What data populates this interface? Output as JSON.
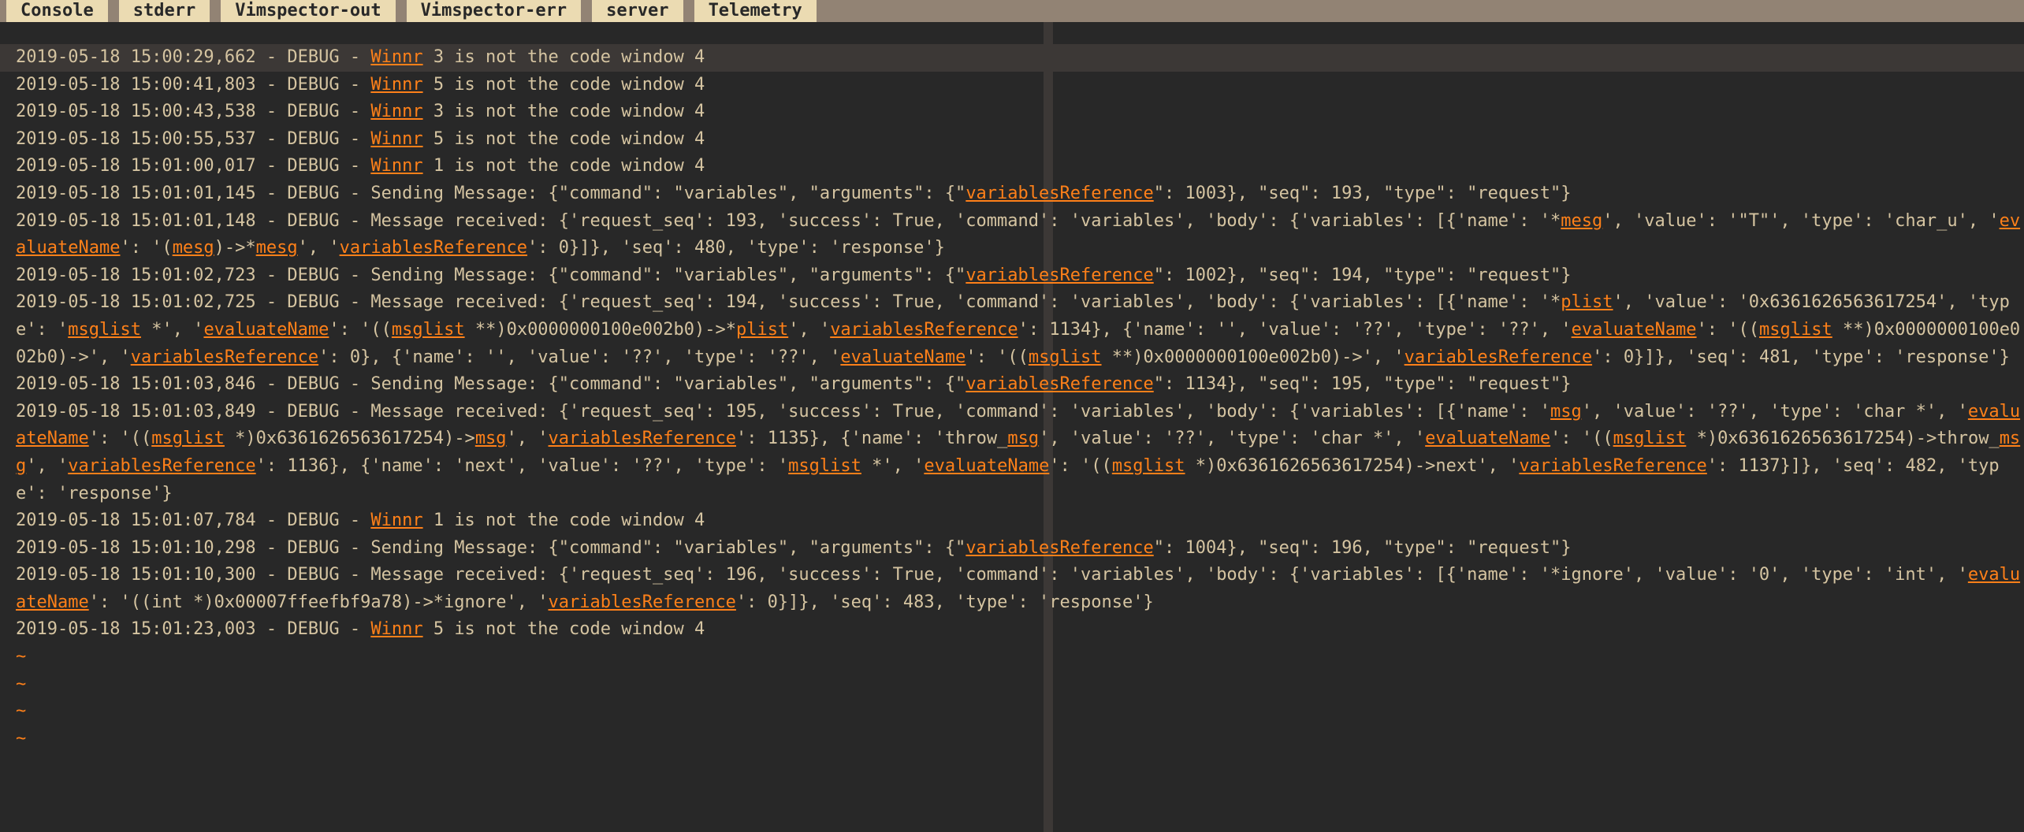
{
  "tabs": [
    "Console",
    "stderr",
    "Vimspector-out",
    "Vimspector-err",
    "server",
    "Telemetry"
  ],
  "lines": [
    [
      {
        "t": "2019-05-18 15:00:29,662 - DEBUG - "
      },
      {
        "t": "Winnr",
        "c": "ul"
      },
      {
        "t": " 3 is not the code window 4"
      }
    ],
    [
      {
        "t": "2019-05-18 15:00:41,803 - DEBUG - "
      },
      {
        "t": "Winnr",
        "c": "ul"
      },
      {
        "t": " 5 is not the code window 4"
      }
    ],
    [
      {
        "t": "2019-05-18 15:00:43,538 - DEBUG - "
      },
      {
        "t": "Winnr",
        "c": "ul"
      },
      {
        "t": " 3 is not the code window 4"
      }
    ],
    [
      {
        "t": "2019-05-18 15:00:55,537 - DEBUG - "
      },
      {
        "t": "Winnr",
        "c": "ul"
      },
      {
        "t": " 5 is not the code window 4"
      }
    ],
    [
      {
        "t": "2019-05-18 15:01:00,017 - DEBUG - "
      },
      {
        "t": "Winnr",
        "c": "ul"
      },
      {
        "t": " 1 is not the code window 4"
      }
    ],
    [
      {
        "t": "2019-05-18 15:01:01,145 - DEBUG - Sending Message: {\"command\": \"variables\", \"arguments\": {\""
      },
      {
        "t": "variablesReference",
        "c": "ul"
      },
      {
        "t": "\": 1003}, \"seq\": 193, \"type\": \"request\"}"
      }
    ],
    [
      {
        "t": "2019-05-18 15:01:01,148 - DEBUG - Message received: {'request_seq': 193, 'success': True, 'command': 'variables', 'body': {'variables': [{'name': '*"
      },
      {
        "t": "mesg",
        "c": "ul"
      },
      {
        "t": "', 'value': '\"T\"', 'type': 'char_u', '"
      },
      {
        "t": "evaluateName",
        "c": "ul"
      },
      {
        "t": "': '("
      },
      {
        "t": "mesg",
        "c": "ul"
      },
      {
        "t": ")->*"
      },
      {
        "t": "mesg",
        "c": "ul"
      },
      {
        "t": "', '"
      },
      {
        "t": "variablesReference",
        "c": "ul"
      },
      {
        "t": "': 0}]}, 'seq': 480, 'type': 'response'}"
      }
    ],
    [
      {
        "t": "2019-05-18 15:01:02,723 - DEBUG - Sending Message: {\"command\": \"variables\", \"arguments\": {\""
      },
      {
        "t": "variablesReference",
        "c": "ul"
      },
      {
        "t": "\": 1002}, \"seq\": 194, \"type\": \"request\"}"
      }
    ],
    [
      {
        "t": "2019-05-18 15:01:02,725 - DEBUG - Message received: {'request_seq': 194, 'success': True, 'command': 'variables', 'body': {'variables': [{'name': '*"
      },
      {
        "t": "plist",
        "c": "ul"
      },
      {
        "t": "', 'value': '0x6361626563617254', 'type': '"
      },
      {
        "t": "msglist",
        "c": "ul"
      },
      {
        "t": " *', '"
      },
      {
        "t": "evaluateName",
        "c": "ul"
      },
      {
        "t": "': '(("
      },
      {
        "t": "msglist",
        "c": "ul"
      },
      {
        "t": " **)0x0000000100e002b0)->*"
      },
      {
        "t": "plist",
        "c": "ul"
      },
      {
        "t": "', '"
      },
      {
        "t": "variablesReference",
        "c": "ul"
      },
      {
        "t": "': 1134}, {'name': '', 'value': '??', 'type': '??', '"
      },
      {
        "t": "evaluateName",
        "c": "ul"
      },
      {
        "t": "': '(("
      },
      {
        "t": "msglist",
        "c": "ul"
      },
      {
        "t": " **)0x0000000100e002b0)->', '"
      },
      {
        "t": "variablesReference",
        "c": "ul"
      },
      {
        "t": "': 0}, {'name': '', 'value': '??', 'type': '??', '"
      },
      {
        "t": "evaluateName",
        "c": "ul"
      },
      {
        "t": "': '(("
      },
      {
        "t": "msglist",
        "c": "ul"
      },
      {
        "t": " **)0x0000000100e002b0)->', '"
      },
      {
        "t": "variablesReference",
        "c": "ul"
      },
      {
        "t": "': 0}]}, 'seq': 481, 'type': 'response'}"
      }
    ],
    [
      {
        "t": "2019-05-18 15:01:03,846 - DEBUG - Sending Message: {\"command\": \"variables\", \"arguments\": {\""
      },
      {
        "t": "variablesReference",
        "c": "ul"
      },
      {
        "t": "\": 1134}, \"seq\": 195, \"type\": \"request\"}"
      }
    ],
    [
      {
        "t": "2019-05-18 15:01:03,849 - DEBUG - Message received: {'request_seq': 195, 'success': True, 'command': 'variables', 'body': {'variables': [{'name': '"
      },
      {
        "t": "msg",
        "c": "ul"
      },
      {
        "t": "', 'value': '??', 'type': 'char *', '"
      },
      {
        "t": "evaluateName",
        "c": "ul"
      },
      {
        "t": "': '(("
      },
      {
        "t": "msglist",
        "c": "ul"
      },
      {
        "t": " *)0x6361626563617254)->"
      },
      {
        "t": "msg",
        "c": "ul"
      },
      {
        "t": "', '"
      },
      {
        "t": "variablesReference",
        "c": "ul"
      },
      {
        "t": "': 1135}, {'name': 'throw_"
      },
      {
        "t": "msg",
        "c": "ul"
      },
      {
        "t": "', 'value': '??', 'type': 'char *', '"
      },
      {
        "t": "evaluateName",
        "c": "ul"
      },
      {
        "t": "': '(("
      },
      {
        "t": "msglist",
        "c": "ul"
      },
      {
        "t": " *)0x6361626563617254)->throw_"
      },
      {
        "t": "msg",
        "c": "ul"
      },
      {
        "t": "', '"
      },
      {
        "t": "variablesReference",
        "c": "ul"
      },
      {
        "t": "': 1136}, {'name': 'next', 'value': '??', 'type': '"
      },
      {
        "t": "msglist",
        "c": "ul"
      },
      {
        "t": " *', '"
      },
      {
        "t": "evaluateName",
        "c": "ul"
      },
      {
        "t": "': '(("
      },
      {
        "t": "msglist",
        "c": "ul"
      },
      {
        "t": " *)0x6361626563617254)->next', '"
      },
      {
        "t": "variablesReference",
        "c": "ul"
      },
      {
        "t": "': 1137}]}, 'seq': 482, 'type': 'response'}"
      }
    ],
    [
      {
        "t": "2019-05-18 15:01:07,784 - DEBUG - "
      },
      {
        "t": "Winnr",
        "c": "ul"
      },
      {
        "t": " 1 is not the code window 4"
      }
    ],
    [
      {
        "t": "2019-05-18 15:01:10,298 - DEBUG - Sending Message: {\"command\": \"variables\", \"arguments\": {\""
      },
      {
        "t": "variablesReference",
        "c": "ul"
      },
      {
        "t": "\": 1004}, \"seq\": 196, \"type\": \"request\"}"
      }
    ],
    [
      {
        "t": "2019-05-18 15:01:10,300 - DEBUG - Message received: {'request_seq': 196, 'success': True, 'command': 'variables', 'body': {'variables': [{'name': '*ignore', 'value': '0', 'type': 'int', '"
      },
      {
        "t": "evaluateName",
        "c": "ul"
      },
      {
        "t": "': '((int *)0x00007ffeefbf9a78)->*ignore', '"
      },
      {
        "t": "variablesReference",
        "c": "ul"
      },
      {
        "t": "': 0}]}, 'seq': 483, 'type': 'response'}"
      }
    ],
    [
      {
        "t": "2019-05-18 15:01:23,003 - DEBUG - "
      },
      {
        "t": "Winnr",
        "c": "ul"
      },
      {
        "t": " 5 is not the code window 4"
      }
    ]
  ],
  "cursor_line_index": 14,
  "tildes": 4
}
